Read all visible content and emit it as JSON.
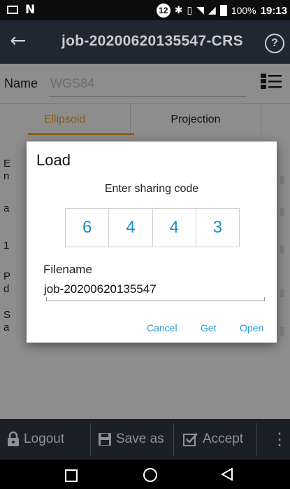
{
  "status_bar": {
    "notification_count": "12",
    "battery": "100%",
    "time": "19:13"
  },
  "app_bar": {
    "title": "job-20200620135547-CRS",
    "back_icon": "arrow-left",
    "help_icon": "question-circle"
  },
  "name_row": {
    "label": "Name",
    "value": "WGS84"
  },
  "tabs": [
    {
      "label": "Ellipsoid",
      "active": true
    },
    {
      "label": "Projection",
      "active": false
    }
  ],
  "background_fragments": [
    "E",
    "n",
    "a",
    "1",
    "P",
    "d",
    "S",
    "a"
  ],
  "dialog": {
    "title": "Load",
    "prompt": "Enter sharing code",
    "code_digits": [
      "6",
      "4",
      "4",
      "3"
    ],
    "filename_label": "Filename",
    "filename_value": "job-20200620135547",
    "buttons": {
      "cancel": "Cancel",
      "get": "Get",
      "open": "Open"
    }
  },
  "bottom_bar": {
    "logout": "Logout",
    "save_as": "Save as",
    "accept": "Accept"
  },
  "colors": {
    "accent_blue": "#2a9ad8",
    "tab_active": "#8a5e12",
    "app_bar": "#1f2733",
    "bottom_bar": "#1b1f27"
  }
}
